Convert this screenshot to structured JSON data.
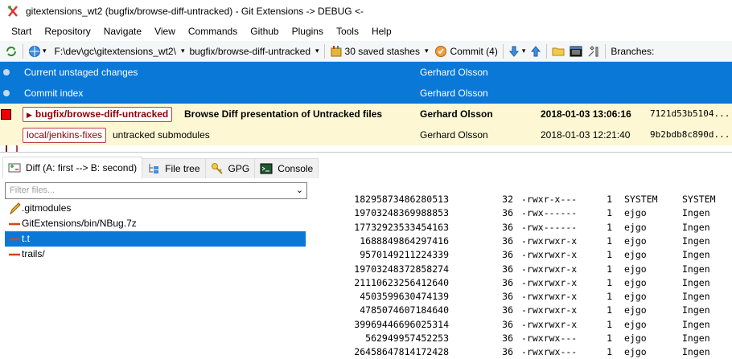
{
  "window": {
    "title": "gitextensions_wt2 (bugfix/browse-diff-untracked) - Git Extensions -> DEBUG <-"
  },
  "menu": [
    "Start",
    "Repository",
    "Navigate",
    "View",
    "Commands",
    "Github",
    "Plugins",
    "Tools",
    "Help"
  ],
  "toolbar": {
    "repo_path": "F:\\dev\\gc\\gitextensions_wt2\\",
    "branch": "bugfix/browse-diff-untracked",
    "stashes": "30 saved stashes",
    "commit": "Commit (4)",
    "branches_label": "Branches:"
  },
  "revisions": [
    {
      "message": "Current unstaged changes",
      "author": "Gerhard Olsson",
      "date": "",
      "hash": ""
    },
    {
      "message": "Commit index",
      "author": "Gerhard Olsson",
      "date": "",
      "hash": ""
    },
    {
      "branch_tag": "bugfix/browse-diff-untracked",
      "message": "Browse Diff presentation of Untracked files",
      "author": "Gerhard Olsson",
      "date": "2018-01-03 13:06:16",
      "hash": "7121d53b5104..."
    },
    {
      "branch_tag": "local/jenkins-fixes",
      "message": "untracked submodules",
      "author": "Gerhard Olsson",
      "date": "2018-01-03 12:21:40",
      "hash": "9b2bdb8c890d..."
    }
  ],
  "tabs": [
    "Diff (A: first --> B: second)",
    "File tree",
    "GPG",
    "Console"
  ],
  "filter_placeholder": "Filter files...",
  "files": [
    ".gitmodules",
    "GitExtensions/bin/NBug.7z",
    "t.t",
    "trails/"
  ],
  "diff_lines": [
    {
      "inode": "18295873486280513",
      "size": "32",
      "perm": "-rwxr-x---",
      "links": "1",
      "owner": "SYSTEM",
      "group": "SYSTEM"
    },
    {
      "inode": "19703248369988853",
      "size": "36",
      "perm": "-rwx------",
      "links": "1",
      "owner": "ejgo",
      "group": "Ingen"
    },
    {
      "inode": "17732923533454163",
      "size": "36",
      "perm": "-rwx------",
      "links": "1",
      "owner": "ejgo",
      "group": "Ingen"
    },
    {
      "inode": "1688849864297416",
      "size": "36",
      "perm": "-rwxrwxr-x",
      "links": "1",
      "owner": "ejgo",
      "group": "Ingen"
    },
    {
      "inode": "9570149211224339",
      "size": "36",
      "perm": "-rwxrwxr-x",
      "links": "1",
      "owner": "ejgo",
      "group": "Ingen"
    },
    {
      "inode": "19703248372858274",
      "size": "36",
      "perm": "-rwxrwxr-x",
      "links": "1",
      "owner": "ejgo",
      "group": "Ingen"
    },
    {
      "inode": "21110623256412640",
      "size": "36",
      "perm": "-rwxrwxr-x",
      "links": "1",
      "owner": "ejgo",
      "group": "Ingen"
    },
    {
      "inode": "4503599630474139",
      "size": "36",
      "perm": "-rwxrwxr-x",
      "links": "1",
      "owner": "ejgo",
      "group": "Ingen"
    },
    {
      "inode": "4785074607184640",
      "size": "36",
      "perm": "-rwxrwxr-x",
      "links": "1",
      "owner": "ejgo",
      "group": "Ingen"
    },
    {
      "inode": "39969446696025314",
      "size": "36",
      "perm": "-rwxrwxr-x",
      "links": "1",
      "owner": "ejgo",
      "group": "Ingen"
    },
    {
      "inode": "562949957452253",
      "size": "36",
      "perm": "-rwxrwx---",
      "links": "1",
      "owner": "ejgo",
      "group": "Ingen"
    },
    {
      "inode": "26458647814172428",
      "size": "36",
      "perm": "-rwxrwx---",
      "links": "1",
      "owner": "ejgo",
      "group": "Ingen"
    }
  ],
  "colors": {
    "selection": "#0a78d7",
    "current_row": "#fdf8d3",
    "branch_tag_text": "#8b0000"
  }
}
